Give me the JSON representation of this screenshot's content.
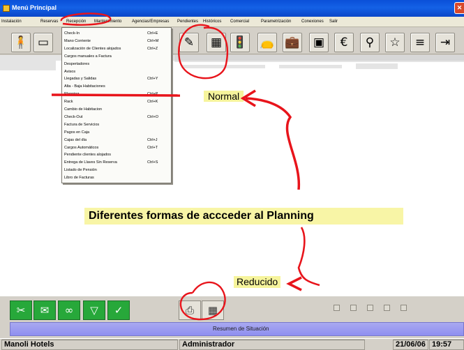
{
  "window": {
    "title": "Menú Principal",
    "close_glyph": "✕"
  },
  "menubar": {
    "items": [
      "Instalación",
      "Reservas",
      "Recepción",
      "Mantenimiento",
      "Agencias/Empresas",
      "Pendientes",
      "Históricos",
      "Comercial",
      "Parametrización",
      "Conexiones",
      "Salir"
    ]
  },
  "toolbar": {
    "icons": [
      {
        "name": "receptionist-icon",
        "glyph": "🧍"
      },
      {
        "name": "picture-icon",
        "glyph": "▭"
      },
      {
        "name": "pencil-icon",
        "glyph": "✎"
      },
      {
        "name": "planning-grid-icon",
        "glyph": "▦"
      },
      {
        "name": "traffic-light-icon",
        "glyph": "🚦"
      },
      {
        "name": "bag-icon",
        "glyph": "👝"
      },
      {
        "name": "briefcase-icon",
        "glyph": "💼"
      },
      {
        "name": "calendar-icon",
        "glyph": "▣"
      },
      {
        "name": "euro-icon",
        "glyph": "€"
      },
      {
        "name": "tap-icon",
        "glyph": "⚲"
      },
      {
        "name": "star-icon",
        "glyph": "☆"
      },
      {
        "name": "document-icon",
        "glyph": "≡"
      },
      {
        "name": "exit-icon",
        "glyph": "⇥"
      }
    ]
  },
  "dropdown": {
    "items": [
      {
        "label": "Check-In",
        "shortcut": "Ctrl+E"
      },
      {
        "label": "Mano Corriente",
        "shortcut": "Ctrl+M"
      },
      {
        "label": "Localización de Clientes alojados",
        "shortcut": "Ctrl+Z"
      },
      {
        "label": "Cargos manuales a Factura",
        "shortcut": ""
      },
      {
        "label": "Despertadores",
        "shortcut": ""
      },
      {
        "label": "Avisos",
        "shortcut": ""
      },
      {
        "label": "Llegadas y Salidas",
        "shortcut": "Ctrl+Y"
      },
      {
        "label": "Alta - Baja Habitaciones",
        "shortcut": ""
      },
      {
        "label": "Planning",
        "shortcut": "Ctrl+P"
      },
      {
        "label": "Rack",
        "shortcut": "Ctrl+K"
      },
      {
        "label": "Cambio de Habitacion",
        "shortcut": ""
      },
      {
        "label": "Check-Out",
        "shortcut": "Ctrl+O"
      },
      {
        "label": "Factura de Servicios",
        "shortcut": ""
      },
      {
        "label": "Pagos en Caja",
        "shortcut": ""
      },
      {
        "label": "Cajas del día",
        "shortcut": "Ctrl+J"
      },
      {
        "label": "Cargos Automáticos",
        "shortcut": "Ctrl+T"
      },
      {
        "label": "Pendiente clientes alojados",
        "shortcut": ""
      },
      {
        "label": "Entrega de Llaves Sin Reserva",
        "shortcut": "Ctrl+S"
      },
      {
        "label": "Listado de Pensión",
        "shortcut": ""
      },
      {
        "label": "Libro de Facturas",
        "shortcut": ""
      }
    ]
  },
  "annotations": {
    "normal": "Normal",
    "headline": "Diferentes formas de accceder al Planning",
    "reducido": "Reducido",
    "color": "#e8141b"
  },
  "bottom_toolbar": {
    "icons": [
      {
        "name": "scissors-icon",
        "glyph": "✂"
      },
      {
        "name": "mail-icon",
        "glyph": "✉"
      },
      {
        "name": "binoculars-icon",
        "glyph": "∞"
      },
      {
        "name": "triangle-down-icon",
        "glyph": "▽"
      },
      {
        "name": "check-icon",
        "glyph": "✓"
      },
      {
        "name": "printer-icon",
        "glyph": "⎙"
      },
      {
        "name": "planning-grid-icon",
        "glyph": "▦"
      }
    ]
  },
  "status_band": {
    "text": "Resumen de Situación"
  },
  "statusbar": {
    "company": "Manoli Hotels",
    "user": "Administrador",
    "date": "21/06/06",
    "time": "19:57"
  }
}
